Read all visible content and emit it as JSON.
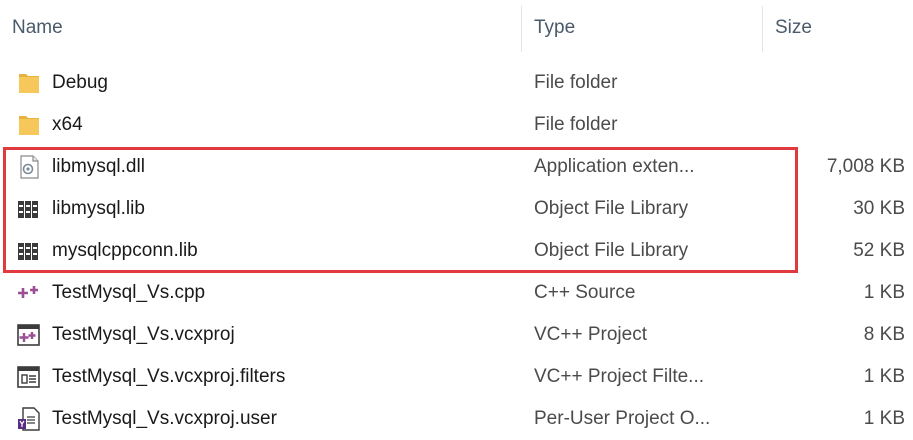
{
  "columns": {
    "name": "Name",
    "type": "Type",
    "size": "Size"
  },
  "files": [
    {
      "name": "Debug",
      "type": "File folder",
      "size": "",
      "icon": "folder-icon"
    },
    {
      "name": "x64",
      "type": "File folder",
      "size": "",
      "icon": "folder-icon"
    },
    {
      "name": "libmysql.dll",
      "type": "Application exten...",
      "size": "7,008 KB",
      "icon": "dll-file-icon"
    },
    {
      "name": "libmysql.lib",
      "type": "Object File Library",
      "size": "30 KB",
      "icon": "library-file-icon"
    },
    {
      "name": "mysqlcppconn.lib",
      "type": "Object File Library",
      "size": "52 KB",
      "icon": "library-file-icon"
    },
    {
      "name": "TestMysql_Vs.cpp",
      "type": "C++ Source",
      "size": "1 KB",
      "icon": "cpp-file-icon"
    },
    {
      "name": "TestMysql_Vs.vcxproj",
      "type": "VC++ Project",
      "size": "8 KB",
      "icon": "vcxproj-file-icon"
    },
    {
      "name": "TestMysql_Vs.vcxproj.filters",
      "type": "VC++ Project Filte...",
      "size": "1 KB",
      "icon": "filters-file-icon"
    },
    {
      "name": "TestMysql_Vs.vcxproj.user",
      "type": "Per-User Project O...",
      "size": "1 KB",
      "icon": "user-file-icon"
    }
  ],
  "colors": {
    "highlight_border": "#e0393e",
    "folder": "#f6c75a"
  }
}
